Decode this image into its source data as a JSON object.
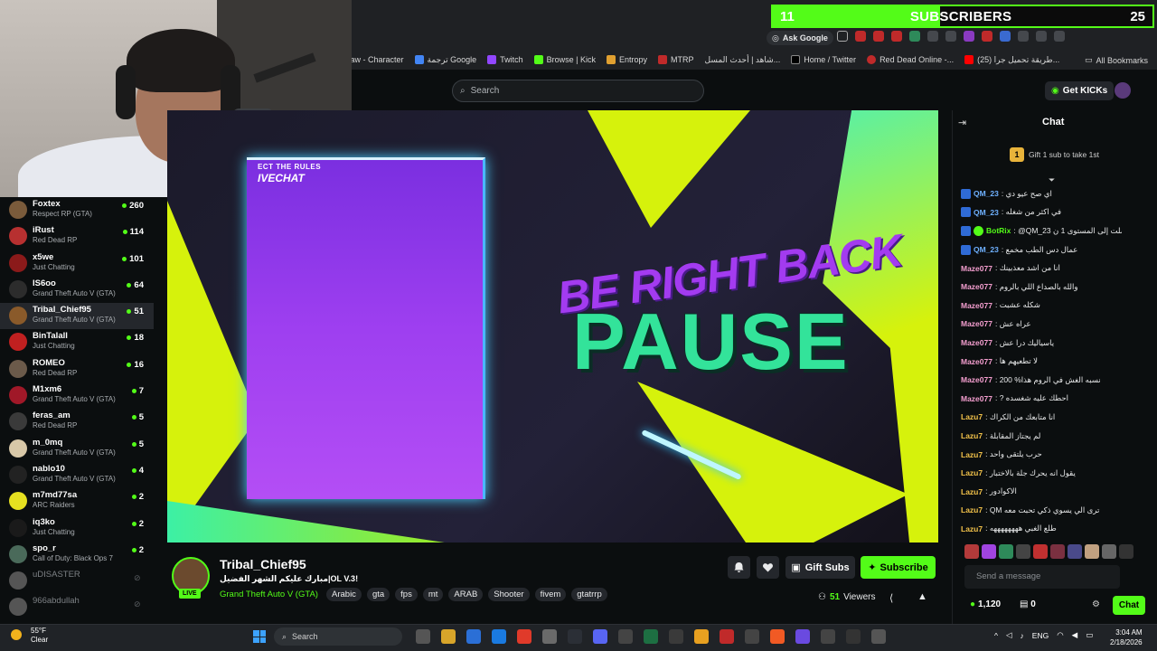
{
  "subscriber_goal": {
    "current": "11",
    "label": "SUBSCRIBERS",
    "target": "25",
    "progress": 0.44
  },
  "browser": {
    "ask_google": "Ask Google",
    "bookmarks": [
      "tLaw - Character",
      "ترجمة Google",
      "Twitch",
      "Browse | Kick",
      "Entropy",
      "MTRP",
      "شاهد | أحدث المسل...",
      "Home / Twitter",
      "Red Dead Online -...",
      "(25) طريقة تحميل جرا..."
    ],
    "all_bookmarks": "All Bookmarks"
  },
  "header": {
    "search_placeholder": "Search",
    "get_kicks": "Get KICKs"
  },
  "sidebar": {
    "items": [
      {
        "name": "Foxtex",
        "category": "Respect RP (GTA)",
        "viewers": "260",
        "color": "#7a5b3b"
      },
      {
        "name": "iRust",
        "category": "Red Dead RP",
        "viewers": "114",
        "color": "#b73030"
      },
      {
        "name": "x5we",
        "category": "Just Chatting",
        "viewers": "101",
        "color": "#8b1a1a"
      },
      {
        "name": "IS6oo",
        "category": "Grand Theft Auto V (GTA)",
        "viewers": "64",
        "color": "#2c2c2c"
      },
      {
        "name": "Tribal_Chief95",
        "category": "Grand Theft Auto V (GTA)",
        "viewers": "51",
        "color": "#8a5a2a"
      },
      {
        "name": "BinTalall",
        "category": "Just Chatting",
        "viewers": "18",
        "color": "#c02020"
      },
      {
        "name": "ROMEO",
        "category": "Red Dead RP",
        "viewers": "16",
        "color": "#6b5a4a"
      },
      {
        "name": "M1xm6",
        "category": "Grand Theft Auto V (GTA)",
        "viewers": "7",
        "color": "#a01828"
      },
      {
        "name": "feras_am",
        "category": "Red Dead RP",
        "viewers": "5",
        "color": "#3a3a3a"
      },
      {
        "name": "m_0mq",
        "category": "Grand Theft Auto V (GTA)",
        "viewers": "5",
        "color": "#d8c8a8"
      },
      {
        "name": "nablo10",
        "category": "Grand Theft Auto V (GTA)",
        "viewers": "4",
        "color": "#222222"
      },
      {
        "name": "m7md77sa",
        "category": "ARC Raiders",
        "viewers": "2",
        "color": "#e6e020"
      },
      {
        "name": "iq3ko",
        "category": "Just Chatting",
        "viewers": "2",
        "color": "#1a1a1a"
      },
      {
        "name": "spo_r",
        "category": "Call of Duty: Black Ops 7",
        "viewers": "2",
        "color": "#4a6a5a"
      }
    ],
    "offline": [
      {
        "name": "uDISASTER",
        "color": "#555555"
      },
      {
        "name": "966abdullah",
        "color": "#555555"
      }
    ]
  },
  "player": {
    "overlay_small": "ECT THE RULES",
    "overlay_brand": "IVECHAT",
    "brb": "BE RIGHT BACK",
    "pause": "PAUSE"
  },
  "stream": {
    "live": "LIVE",
    "channel": "Tribal_Chief95",
    "title": "!OL V.3|مبارك عليكم الشهر الفضيل",
    "category": "Grand Theft Auto V (GTA)",
    "tags": [
      "Arabic",
      "gta",
      "fps",
      "mt",
      "ARAB",
      "Shooter",
      "fivem",
      "gtatrrp"
    ],
    "gift_subs": "Gift Subs",
    "subscribe": "Subscribe",
    "viewers": "51",
    "viewers_label": "Viewers"
  },
  "chat": {
    "title": "Chat",
    "gift_count": "1",
    "gift_text": "Gift 1 sub to take 1st",
    "messages": [
      {
        "user": "QM_23",
        "text": ": اي صح عيو دي",
        "color": "#6fb1ff",
        "badge": "blue"
      },
      {
        "user": "QM_23",
        "text": ": في اكثر من شغله",
        "color": "#6fb1ff",
        "badge": "blue"
      },
      {
        "user": "BotRix",
        "text": ": @QM_23 وصلت إلى المستوى 1 ن",
        "color": "#53fc18",
        "badge": "bot"
      },
      {
        "user": "QM_23",
        "text": ": عمال دس الطب مخمع",
        "color": "#6fb1ff",
        "badge": "blue"
      },
      {
        "user": "Maze077",
        "text": ": انا من اشد معذبينك",
        "color": "#f59fd0",
        "badge": ""
      },
      {
        "user": "Maze077",
        "text": ": والله بالصداع اللي بالروم",
        "color": "#f59fd0",
        "badge": ""
      },
      {
        "user": "Maze077",
        "text": ": شكله عشبت",
        "color": "#f59fd0",
        "badge": ""
      },
      {
        "user": "Maze077",
        "text": ": عراه عش",
        "color": "#f59fd0",
        "badge": ""
      },
      {
        "user": "Maze077",
        "text": ": ياسياليك درا عش",
        "color": "#f59fd0",
        "badge": ""
      },
      {
        "user": "Maze077",
        "text": ": لا تطعيهم ها",
        "color": "#f59fd0",
        "badge": ""
      },
      {
        "user": "Maze077",
        "text": ": 200 %نسبه الغش في الروم هذا",
        "color": "#f59fd0",
        "badge": ""
      },
      {
        "user": "Maze077",
        "text": ": ? احطك عليه شغسده",
        "color": "#f59fd0",
        "badge": ""
      },
      {
        "user": "Lazu7",
        "text": ": انا متابعك من الكراك",
        "color": "#f2c24a",
        "badge": ""
      },
      {
        "user": "Lazu7",
        "text": ": لم يجتاز المقابلة",
        "color": "#f2c24a",
        "badge": ""
      },
      {
        "user": "Lazu7",
        "text": ": حرب يلتقى واحد",
        "color": "#f2c24a",
        "badge": ""
      },
      {
        "user": "Lazu7",
        "text": ": يقول انه يحرك جلة بالاختبار",
        "color": "#f2c24a",
        "badge": ""
      },
      {
        "user": "Lazu7",
        "text": ": الاكوادور",
        "color": "#f2c24a",
        "badge": ""
      },
      {
        "user": "Lazu7",
        "text": ": QM ترى الي يسوي ذكي تحبت معه",
        "color": "#f2c24a",
        "badge": ""
      },
      {
        "user": "Lazu7",
        "text": ": طلع الغبي ههههههههه",
        "color": "#f2c24a",
        "badge": ""
      }
    ],
    "emote_colors": [
      "#b33a3a",
      "#a044e0",
      "#2e8a5a",
      "#444",
      "#c03030",
      "#7a3040",
      "#4a4a8a",
      "#c0a080",
      "#666",
      "#333"
    ],
    "send_placeholder": "Send a message",
    "points": "1,120",
    "chests": "0",
    "chat_button": "Chat"
  },
  "taskbar": {
    "temperature": "55°F",
    "condition": "Clear",
    "search": "Search",
    "lang": "ENG",
    "time": "3:04 AM",
    "date": "2/18/2026",
    "app_colors": [
      "#555",
      "#d8a52a",
      "#2b6fd6",
      "#1a7ae0",
      "#e03a2a",
      "#6a6a6a",
      "#2b2f36",
      "#5865f2",
      "#444",
      "#1d6f42",
      "#3a3a3a",
      "#e8a020",
      "#c02a2a",
      "#444",
      "#f15a24",
      "#6a4ae0",
      "#444",
      "#333",
      "#555"
    ]
  }
}
